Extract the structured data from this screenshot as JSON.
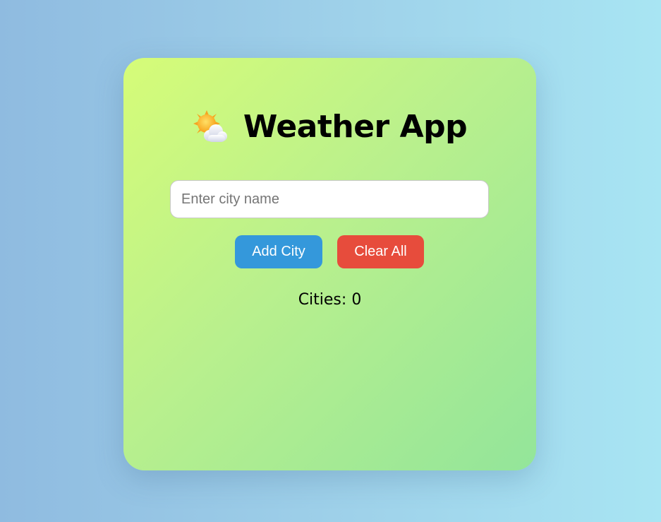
{
  "app": {
    "title": "Weather App",
    "title_icon": "sun-behind-cloud-icon"
  },
  "search": {
    "placeholder": "Enter city name",
    "value": ""
  },
  "actions": {
    "add_label": "Add City",
    "clear_label": "Clear All"
  },
  "status": {
    "cities_label": "Cities:",
    "cities_count": "0"
  },
  "colors": {
    "add_button": "#3498db",
    "clear_button": "#e74c3c",
    "card_gradient_start": "#d6fc78",
    "card_gradient_end": "#93e59a"
  }
}
